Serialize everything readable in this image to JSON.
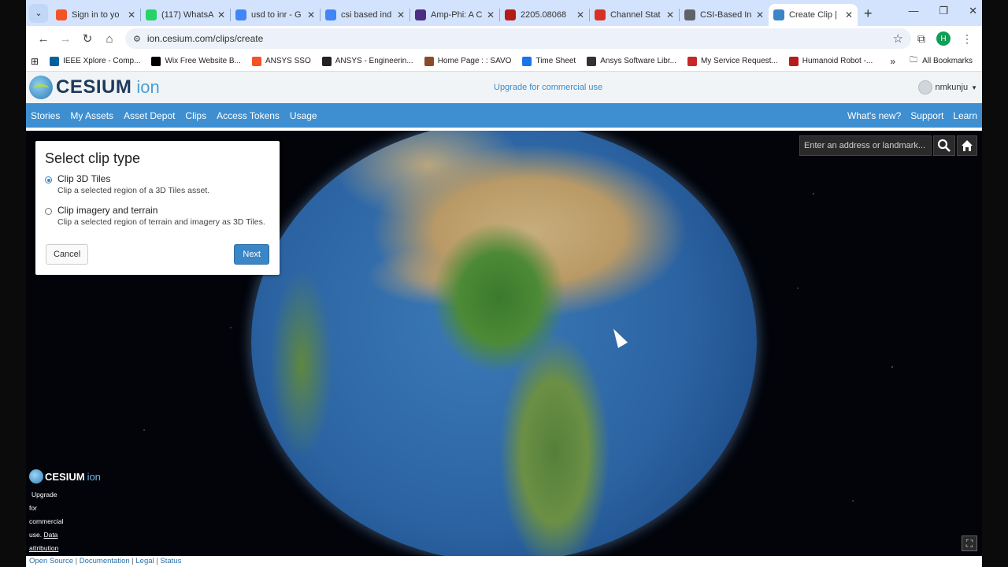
{
  "tabs": [
    {
      "title": "Sign in to yo",
      "favicon": "microsoft-icon",
      "color": "#f35325"
    },
    {
      "title": "(117) WhatsA",
      "favicon": "whatsapp-icon",
      "color": "#25d366"
    },
    {
      "title": "usd to inr - G",
      "favicon": "google-icon",
      "color": "#4285f4"
    },
    {
      "title": "csi based ind",
      "favicon": "google-icon",
      "color": "#4285f4"
    },
    {
      "title": "Amp-Phi: A C",
      "favicon": "w-icon",
      "color": "#4b2e83"
    },
    {
      "title": "2205.08068",
      "favicon": "arxiv-icon",
      "color": "#b31b1b"
    },
    {
      "title": "Channel Stat",
      "favicon": "doc-icon",
      "color": "#d93025"
    },
    {
      "title": "CSI-Based In",
      "favicon": "globe-icon",
      "color": "#5f6368"
    },
    {
      "title": "Create Clip |",
      "favicon": "cesium-icon",
      "color": "#3b86c6",
      "active": true
    }
  ],
  "address": {
    "url": "ion.cesium.com/clips/create"
  },
  "profile_initial": "H",
  "bookmarks": [
    {
      "label": "IEEE Xplore - Comp...",
      "color": "#00629b"
    },
    {
      "label": "Wix Free Website B...",
      "color": "#000000"
    },
    {
      "label": "ANSYS SSO",
      "color": "#f35325"
    },
    {
      "label": "ANSYS - Engineerin...",
      "color": "#222222"
    },
    {
      "label": "Home Page : : SAVO",
      "color": "#8a4b2a"
    },
    {
      "label": "Time Sheet",
      "color": "#1a73e8"
    },
    {
      "label": "Ansys Software Libr...",
      "color": "#333333"
    },
    {
      "label": "My Service Request...",
      "color": "#c62828"
    },
    {
      "label": "Humanoid Robot -...",
      "color": "#b71c1c"
    }
  ],
  "bookmarks_all": "All Bookmarks",
  "header": {
    "logo_text": "CESIUM",
    "logo_ion": "ion",
    "upgrade": "Upgrade for commercial use",
    "username": "nmkunju"
  },
  "nav": {
    "left": [
      "Stories",
      "My Assets",
      "Asset Depot",
      "Clips",
      "Access Tokens",
      "Usage"
    ],
    "right": [
      "What's new?",
      "Support",
      "Learn"
    ]
  },
  "geocoder": {
    "placeholder": "Enter an address or landmark..."
  },
  "dialog": {
    "title": "Select clip type",
    "options": [
      {
        "title": "Clip 3D Tiles",
        "desc": "Clip a selected region of a 3D Tiles asset.",
        "checked": true
      },
      {
        "title": "Clip imagery and terrain",
        "desc": "Clip a selected region of terrain and imagery as 3D Tiles.",
        "checked": false
      }
    ],
    "cancel": "Cancel",
    "next": "Next"
  },
  "credits": {
    "logo_text": "CESIUM",
    "logo_ion": "ion",
    "line1": "Upgrade",
    "line2": "for",
    "line3": "commercial",
    "line4": "use.",
    "data": "Data",
    "attribution": "attribution"
  },
  "footer": {
    "links": [
      "Open Source",
      "Documentation",
      "Legal",
      "Status"
    ]
  }
}
